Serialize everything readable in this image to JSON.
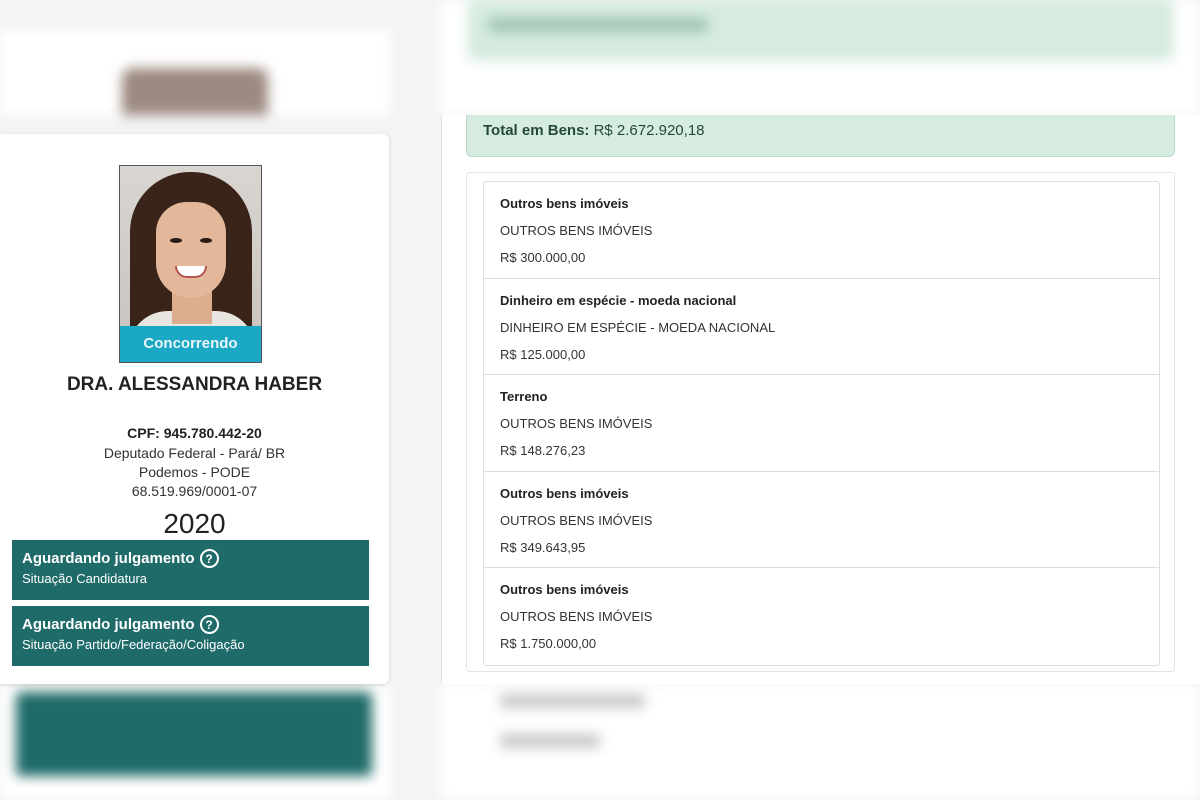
{
  "candidate": {
    "status_badge": "Concorrendo",
    "name": "DRA. ALESSANDRA HABER",
    "cpf_label": "CPF:",
    "cpf": "945.780.442-20",
    "office": "Deputado Federal - Pará/ BR",
    "party": "Podemos - PODE",
    "cnpj": "68.519.969/0001-07",
    "year": "2020"
  },
  "situations": [
    {
      "title": "Aguardando julgamento",
      "subtitle": "Situação Candidatura",
      "icon": "help-circle-icon"
    },
    {
      "title": "Aguardando julgamento",
      "subtitle": "Situação Partido/Federação/Coligação",
      "icon": "help-circle-icon"
    }
  ],
  "assets": {
    "total_label": "Total em Bens:",
    "total_value": "R$ 2.672.920,18",
    "items": [
      {
        "title": "Outros bens imóveis",
        "description": "OUTROS BENS IMÓVEIS",
        "value": "R$ 300.000,00"
      },
      {
        "title": "Dinheiro em espécie - moeda nacional",
        "description": "DINHEIRO EM ESPÉCIE - MOEDA NACIONAL",
        "value": "R$ 125.000,00"
      },
      {
        "title": "Terreno",
        "description": "OUTROS BENS IMÓVEIS",
        "value": "R$ 148.276,23"
      },
      {
        "title": "Outros bens imóveis",
        "description": "OUTROS BENS IMÓVEIS",
        "value": "R$ 349.643,95"
      },
      {
        "title": "Outros bens imóveis",
        "description": "OUTROS BENS IMÓVEIS",
        "value": "R$ 1.750.000,00"
      }
    ]
  },
  "colors": {
    "teal": "#1f6b69",
    "badge_blue": "#1aa8c5",
    "total_green": "#d6ece0"
  }
}
